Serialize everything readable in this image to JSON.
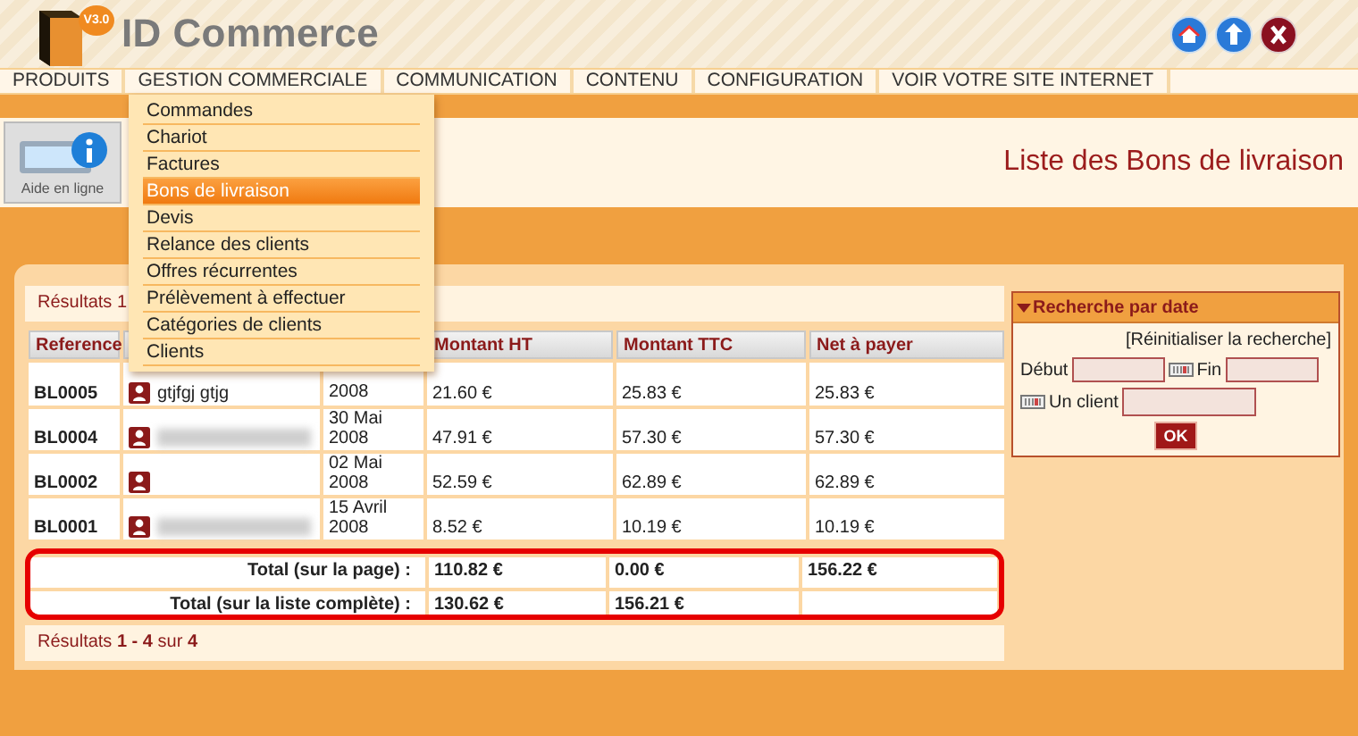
{
  "header": {
    "badge": "V3.0",
    "logo_text": "ID Commerce"
  },
  "nav": [
    {
      "label": "PRODUITS"
    },
    {
      "label": "GESTION COMMERCIALE"
    },
    {
      "label": "COMMUNICATION"
    },
    {
      "label": "CONTENU"
    },
    {
      "label": "CONFIGURATION"
    },
    {
      "label": "VOIR VOTRE SITE INTERNET"
    }
  ],
  "dropdown": [
    {
      "label": "Commandes",
      "selected": false
    },
    {
      "label": "Chariot",
      "selected": false
    },
    {
      "label": "Factures",
      "selected": false
    },
    {
      "label": "Bons de livraison",
      "selected": true
    },
    {
      "label": "Devis",
      "selected": false
    },
    {
      "label": "Relance des clients",
      "selected": false
    },
    {
      "label": "Offres récurrentes",
      "selected": false
    },
    {
      "label": "Prélèvement à effectuer",
      "selected": false
    },
    {
      "label": "Catégories de clients",
      "selected": false
    },
    {
      "label": "Clients",
      "selected": false
    }
  ],
  "help": {
    "label": "Aide en ligne"
  },
  "page_title": "Liste des Bons de livraison",
  "results_top": "Résultats 1",
  "table": {
    "columns": [
      "Reference",
      "Montant HT",
      "Montant TTC",
      "Net à payer"
    ],
    "rows": [
      {
        "reference": "BL0005",
        "client": "gtjfgj gtjg",
        "client_blurred": false,
        "date": "2008",
        "montant_ht": "21.60 €",
        "montant_ttc": "25.83 €",
        "net": "25.83 €"
      },
      {
        "reference": "BL0004",
        "client_blurred": true,
        "date": "30 Mai 2008",
        "montant_ht": "47.91 €",
        "montant_ttc": "57.30 €",
        "net": "57.30 €"
      },
      {
        "reference": "BL0002",
        "client_blurred": false,
        "date": "02 Mai 2008",
        "montant_ht": "52.59 €",
        "montant_ttc": "62.89 €",
        "net": "62.89 €"
      },
      {
        "reference": "BL0001",
        "client_blurred": true,
        "date": "15 Avril 2008",
        "montant_ht": "8.52 €",
        "montant_ttc": "10.19 €",
        "net": "10.19 €"
      }
    ],
    "totals": [
      {
        "label": "Total (sur la page) :",
        "montant_ht": "110.82 €",
        "montant_ttc": "0.00 €",
        "net": "156.22 €"
      },
      {
        "label": "Total (sur la liste complète) :",
        "montant_ht": "130.62 €",
        "montant_ttc": "156.21 €"
      }
    ]
  },
  "results_bottom": "Résultats **1 - 4** sur **4**",
  "search": {
    "title": "Recherche par date",
    "reset": "[Réinitialiser la recherche]",
    "start_label": "Début",
    "end_label": "Fin",
    "client_label": "Un client",
    "ok": "OK"
  }
}
